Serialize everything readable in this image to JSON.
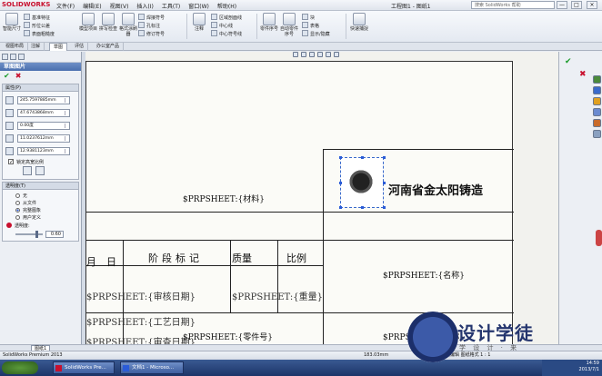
{
  "app": {
    "brand": "SOLIDWORKS",
    "menus": [
      "文件(F)",
      "编辑(E)",
      "视图(V)",
      "插入(I)",
      "工具(T)",
      "窗口(W)",
      "帮助(H)"
    ],
    "doc_title": "工程图1 - 图纸1",
    "search_placeholder": "搜索 SolidWorks 帮助",
    "win_min": "—",
    "win_max": "□",
    "win_close": "×"
  },
  "ribbon": {
    "big_buttons": [
      "智能尺寸",
      "模型项目",
      "拼写检查",
      "格式涂刷器",
      "注释",
      "零件序号",
      "自动零件序号"
    ],
    "small_items": [
      "基准特征",
      "形位公差",
      "表面粗糙度",
      "焊接符号",
      "孔标注",
      "修订符号",
      "区域剖面线",
      "中心线",
      "中心符号线",
      "块",
      "表格",
      "显示/隐藏"
    ],
    "group_labels": [
      "快速捕捉"
    ]
  },
  "tabs": [
    "视图布局",
    "注解",
    "草图",
    "评估",
    "办公室产品"
  ],
  "active_tab": 2,
  "property_manager": {
    "title": "草图图片",
    "section_properties": "属性(P)",
    "fields": [
      "245.7597885mm",
      "47.6743868mm",
      "0.00度",
      "11.0237612mm",
      "12.9381123mm"
    ],
    "lock_aspect": "锁定高宽比例",
    "section_transparency": "透明度(T)",
    "radios": [
      "无",
      "从文件",
      "完整图象",
      "用户定义"
    ],
    "selected_radio": 2,
    "transparency_label": "透明度:",
    "transparency_value": "0.60",
    "transparency_level": 0.6
  },
  "sheet": {
    "material_field": "$PRPSHEET:{材料}",
    "name_field": "$PRPSHEET:{名称}",
    "part_no_field": "$PRPSHEET:{零件号}",
    "name_field_bottom": "$PRPSHEET:{名称}",
    "company": "河南省金太阳铸造",
    "col_month": "月",
    "col_day": "日",
    "col_stage_mark": "阶段标记",
    "col_mass": "质量",
    "col_scale": "比例",
    "overlap_row1": "$PRPSHEET:{审核日期}",
    "overlap_row1b": "$PRPSHEET:{重量}",
    "overlap_row2": "$PRPSHEET:{工艺日期}",
    "overlap_row3": "$PRPSHEET:{审查日期}"
  },
  "hscroll": {
    "sheet_tab": "图纸1"
  },
  "status": {
    "left": "SolidWorks Premium 2013",
    "coord": "183.03mm",
    "right": "在编辑 图纸格式   1 : 1"
  },
  "taskbar": {
    "tasks": [
      "SolidWorks Pre...",
      "文档1 - Microso..."
    ],
    "clock_time": "14:59",
    "clock_date": "2013/7/1"
  },
  "watermark": {
    "text": "设计学徒",
    "sub": "学 设 计 · 来"
  },
  "colors": {
    "accent": "#4a6fae",
    "ok": "#1a9b2a",
    "cancel": "#c8102e"
  },
  "icons": [
    "search-icon",
    "check-icon",
    "close-icon",
    "lock-icon",
    "image-icon"
  ]
}
